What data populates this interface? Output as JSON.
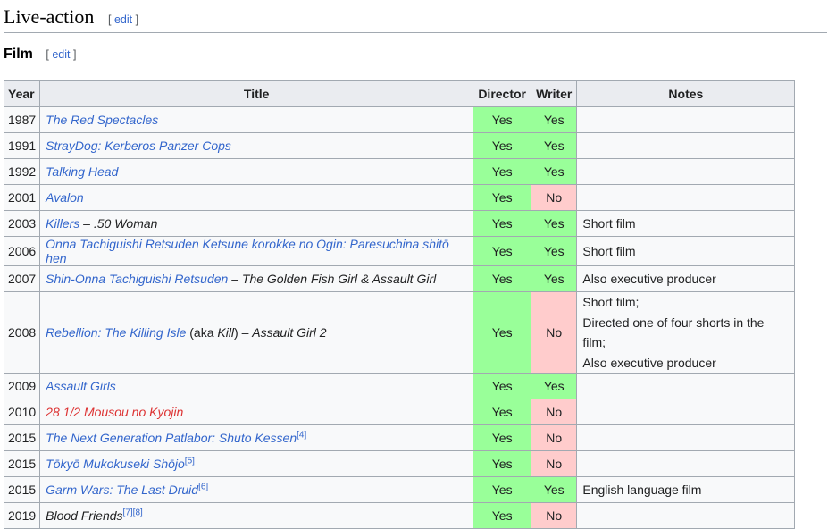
{
  "section": {
    "heading": "Live-action",
    "edit_open": "[",
    "edit_label": "edit",
    "edit_close": "]"
  },
  "subsection": {
    "heading": "Film",
    "edit_open": "[",
    "edit_label": "edit",
    "edit_close": "]"
  },
  "table": {
    "headers": [
      "Year",
      "Title",
      "Director",
      "Writer",
      "Notes"
    ],
    "rows": [
      {
        "year": "1987",
        "title_link": "The Red Spectacles",
        "title_rest": "",
        "sup": "",
        "director": "Yes",
        "writer": "Yes",
        "notes": []
      },
      {
        "year": "1991",
        "title_link": "StrayDog: Kerberos Panzer Cops",
        "title_rest": "",
        "sup": "",
        "director": "Yes",
        "writer": "Yes",
        "notes": []
      },
      {
        "year": "1992",
        "title_link": "Talking Head",
        "title_rest": "",
        "sup": "",
        "director": "Yes",
        "writer": "Yes",
        "notes": []
      },
      {
        "year": "2001",
        "title_link": "Avalon",
        "title_rest": "",
        "sup": "",
        "director": "Yes",
        "writer": "No",
        "notes": []
      },
      {
        "year": "2003",
        "title_link": "Killers",
        "title_rest": " – .50 Woman",
        "sup": "",
        "director": "Yes",
        "writer": "Yes",
        "notes": [
          "Short film"
        ]
      },
      {
        "year": "2006",
        "title_link": "Onna Tachiguishi Retsuden Ketsune korokke no Ogin: Paresuchina shitō hen",
        "title_rest": "",
        "sup": "",
        "director": "Yes",
        "writer": "Yes",
        "notes": [
          "Short film"
        ]
      },
      {
        "year": "2007",
        "title_link": "Shin-Onna Tachiguishi Retsuden",
        "title_rest": " – The Golden Fish Girl & Assault Girl",
        "sup": "",
        "director": "Yes",
        "writer": "Yes",
        "notes": [
          "Also executive producer"
        ]
      },
      {
        "year": "2008",
        "title_link": "Rebellion: The Killing Isle",
        "title_aka_open": " (aka ",
        "title_aka": "Kill",
        "title_aka_close": ")",
        "title_rest": " – Assault Girl 2",
        "sup": "",
        "director": "Yes",
        "writer": "No",
        "notes": [
          "Short film;",
          "Directed one of four shorts in the film;",
          "Also executive producer"
        ]
      },
      {
        "year": "2009",
        "title_link": "Assault Girls",
        "title_rest": "",
        "sup": "",
        "director": "Yes",
        "writer": "Yes",
        "notes": []
      },
      {
        "year": "2010",
        "title_link": "28 1/2 Mousou no Kyojin",
        "title_rest": "",
        "sup": "",
        "director": "Yes",
        "writer": "No",
        "notes": [],
        "redlink": true
      },
      {
        "year": "2015",
        "title_link": "The Next Generation Patlabor: Shuto Kessen",
        "title_rest": "",
        "sup": "[4]",
        "director": "Yes",
        "writer": "No",
        "notes": []
      },
      {
        "year": "2015",
        "title_link": "Tōkyō Mukokuseki Shōjo",
        "title_rest": "",
        "sup": "[5]",
        "director": "Yes",
        "writer": "No",
        "notes": []
      },
      {
        "year": "2015",
        "title_link": "Garm Wars: The Last Druid",
        "title_rest": "",
        "sup": "[6]",
        "director": "Yes",
        "writer": "Yes",
        "notes": [
          "English language film"
        ]
      },
      {
        "year": "2019",
        "title_link": "",
        "title_rest": "Blood Friends",
        "sup": "[7][8]",
        "director": "Yes",
        "writer": "No",
        "notes": []
      }
    ]
  }
}
